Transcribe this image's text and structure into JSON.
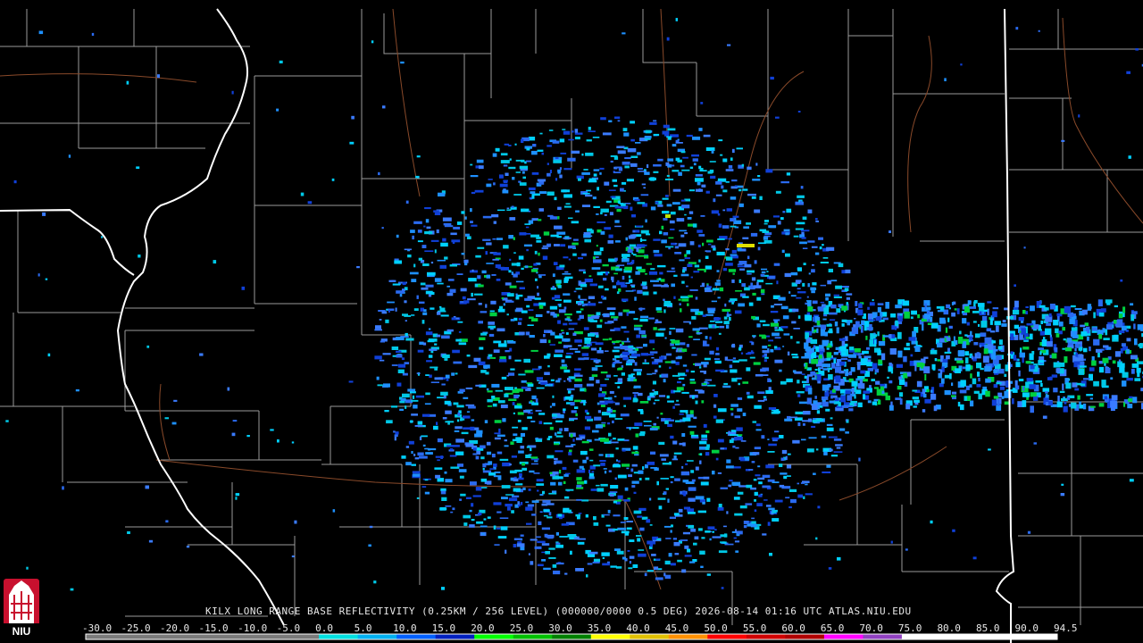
{
  "product": {
    "title": "KILX LONG RANGE BASE REFLECTIVITY (0.25KM / 256 LEVEL) (000000/0000 0.5 DEG) 2026-08-14 01:16 UTC  ATLAS.NIU.EDU"
  },
  "logo": {
    "text": "NIU"
  },
  "colors": {
    "background": "#000000",
    "county_lines": "#9a9a9a",
    "state_lines": "#ffffff",
    "roads": "#8a4a2a"
  },
  "scale": {
    "labels": [
      "-30.0",
      "-25.0",
      "-20.0",
      "-15.0",
      "-10.0",
      "-5.0",
      "0.0",
      "5.0",
      "10.0",
      "15.0",
      "20.0",
      "25.0",
      "30.0",
      "35.0",
      "40.0",
      "45.0",
      "50.0",
      "55.0",
      "60.0",
      "65.0",
      "70.0",
      "75.0",
      "80.0",
      "85.0",
      "90.0",
      "94.5"
    ],
    "colors": [
      "#7a7a7a",
      "#7a7a7a",
      "#7a7a7a",
      "#7a7a7a",
      "#7a7a7a",
      "#7a7a7a",
      "#00e0e0",
      "#00b0f0",
      "#0060ff",
      "#0020c0",
      "#00ff00",
      "#00c000",
      "#008000",
      "#ffff00",
      "#e0c000",
      "#ff9000",
      "#ff0000",
      "#d00000",
      "#b00000",
      "#ff00ff",
      "#9040c0",
      "#ffffff",
      "#ffffff",
      "#ffffff",
      "#ffffff"
    ]
  }
}
